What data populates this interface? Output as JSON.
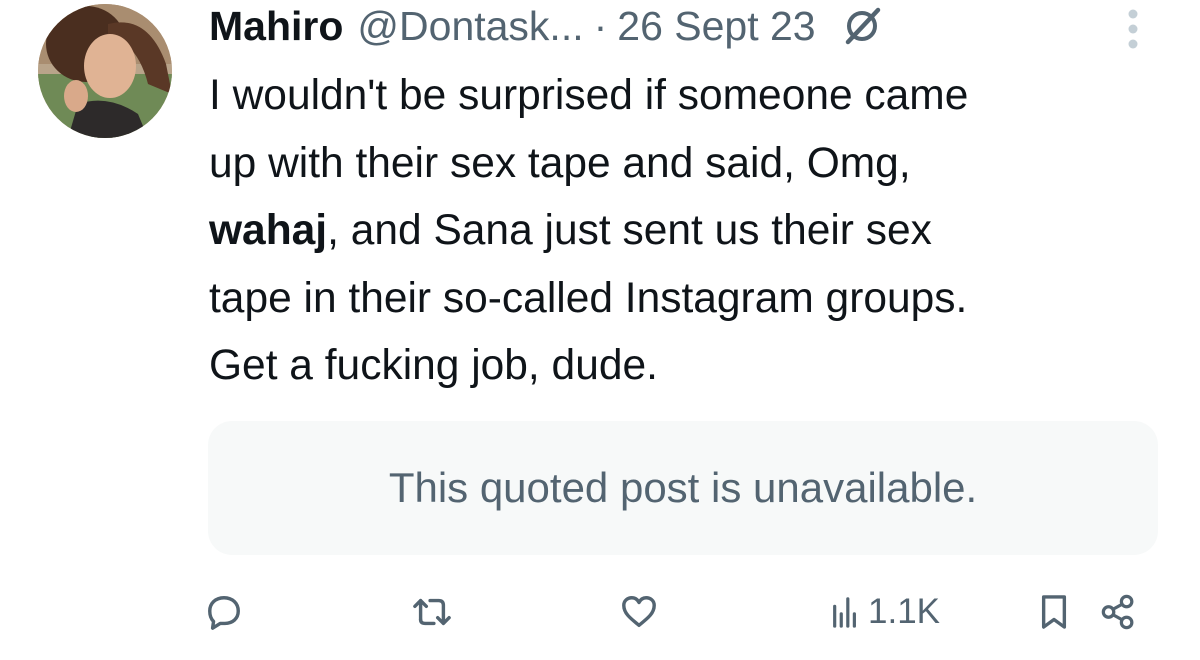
{
  "tweet": {
    "author_name": "Mahiro",
    "handle": "@Dontask...",
    "separator": "·",
    "date": "26 Sept 23",
    "body_lines": [
      "I wouldn't be surprised if someone came",
      "up with their sex tape and said, Omg,",
      {
        "bold": "wahaj",
        "rest": ", and Sana just sent us their sex"
      },
      "tape in their so-called Instagram groups.",
      "Get a fucking job, dude."
    ],
    "quoted_post": "This quoted post is unavailable.",
    "views": "1.1K"
  },
  "icons": {
    "header": [
      "grok-icon",
      "more-icon"
    ],
    "actions": [
      "reply-icon",
      "retweet-icon",
      "like-icon",
      "views-icon",
      "bookmark-icon",
      "share-icon"
    ]
  },
  "colors": {
    "text_primary": "#0f1419",
    "text_secondary": "#536471",
    "quote_background": "#f7f9f9"
  }
}
